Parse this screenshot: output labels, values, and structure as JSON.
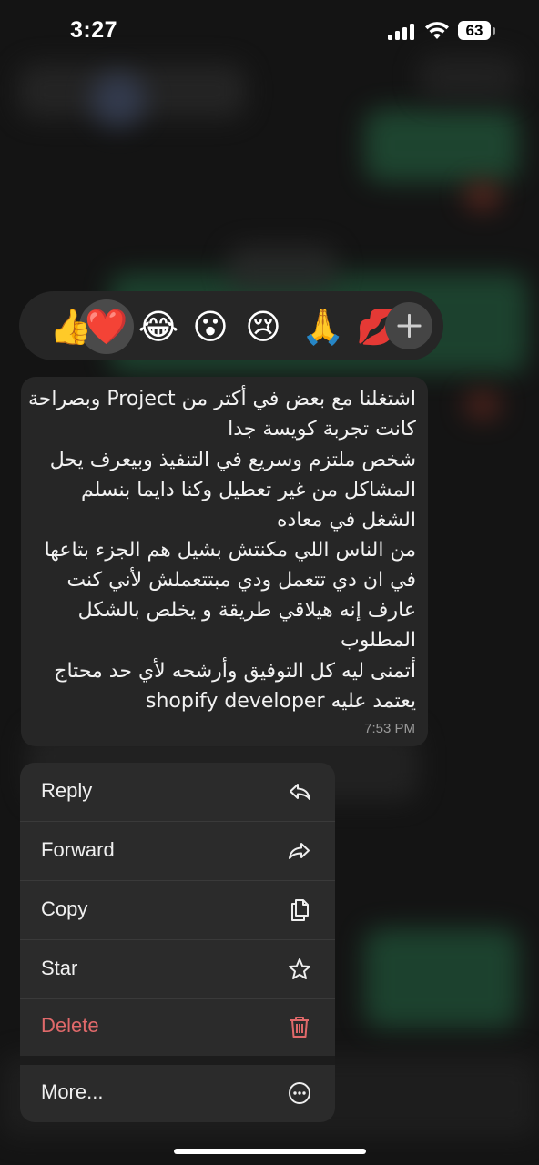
{
  "status_bar": {
    "time": "3:27",
    "battery": "63"
  },
  "reactions": {
    "items": [
      "👍",
      "❤️",
      "😂",
      "😮",
      "😢",
      "🙏",
      "💋"
    ],
    "selected_index": 1,
    "more_label": "+"
  },
  "message": {
    "lines": [
      "اشتغلنا مع بعض في أكتر من Project وبصراحة",
      "كانت تجربة كويسة جدا",
      "شخص ملتزم وسريع في التنفيذ وبيعرف يحل",
      "المشاكل من غير تعطيل وكنا دايما بنسلم",
      "الشغل في معاده",
      "من الناس اللي مكنتش بشيل هم الجزء بتاعها",
      "في ان دي تتعمل ودي مبتتعملش لأني كنت",
      "عارف إنه هيلاقي طريقة و يخلص بالشكل",
      "المطلوب",
      "أتمنى ليه كل التوفيق وأرشحه لأي حد محتاج",
      "shopify developer يعتمد عليه"
    ],
    "time": "7:53 PM"
  },
  "menu": {
    "reply": "Reply",
    "forward": "Forward",
    "copy": "Copy",
    "star": "Star",
    "delete": "Delete",
    "more": "More..."
  },
  "colors": {
    "danger": "#e0696a",
    "bubble": "#262626",
    "menu": "#2b2b2b"
  }
}
